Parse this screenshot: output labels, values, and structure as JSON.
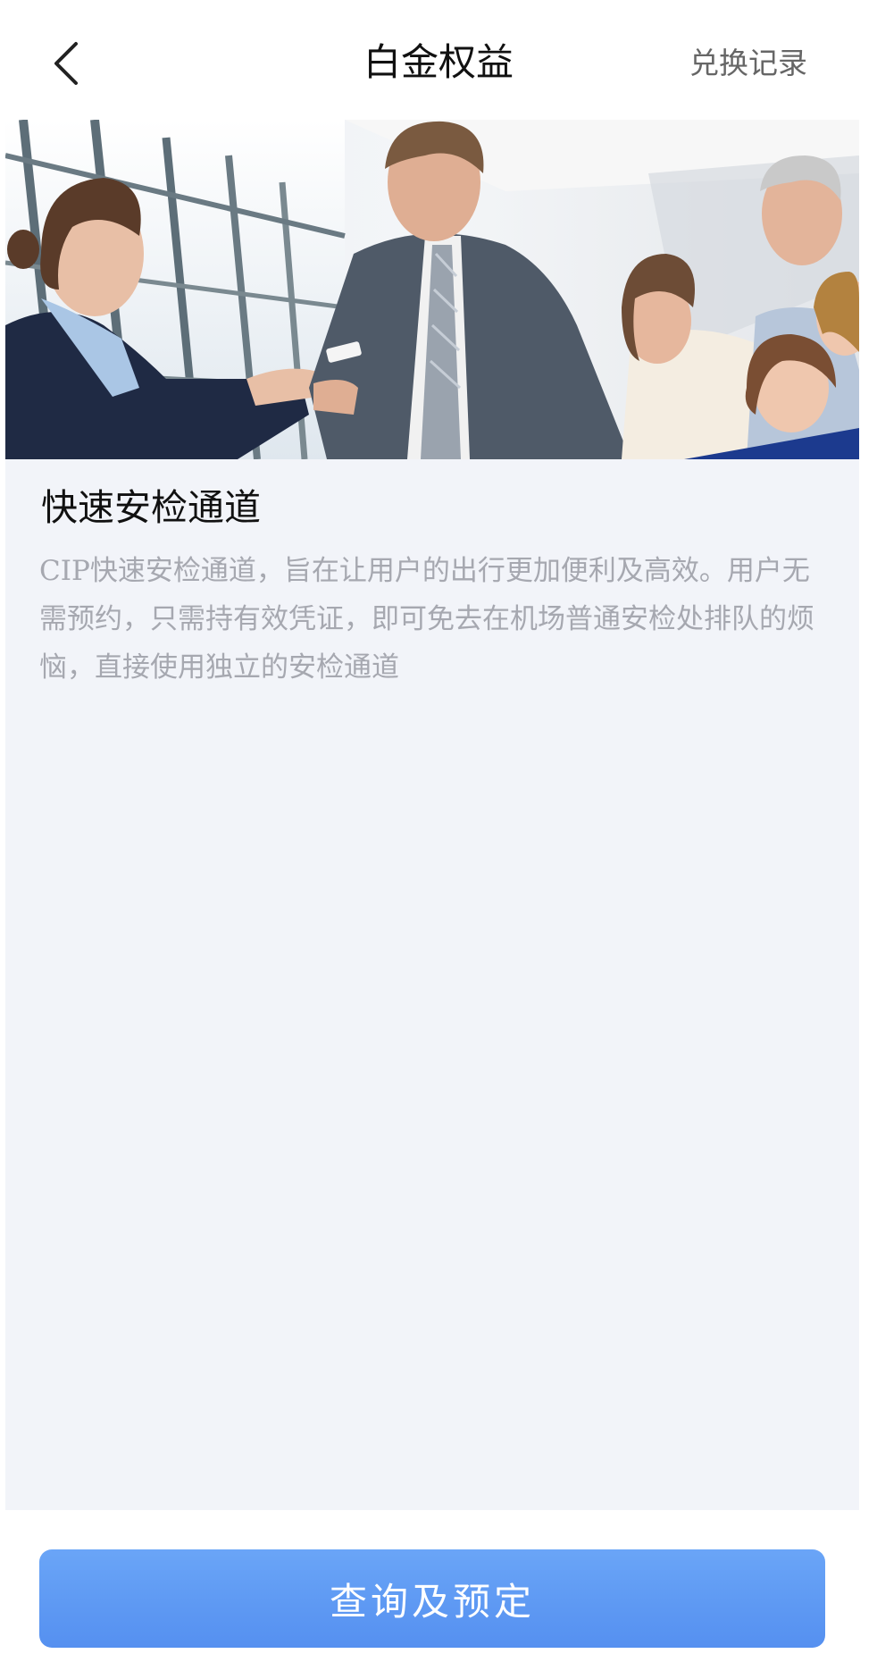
{
  "header": {
    "title": "白金权益",
    "right_link": "兑换记录"
  },
  "hero": {
    "description": "Airport staff checking a traveler's ticket beside a smiling family"
  },
  "benefit": {
    "title": "快速安检通道",
    "description": "CIP快速安检通道，旨在让用户的出行更加便利及高效。用户无需预约，只需持有效凭证，即可免去在机场普通安检处排队的烦恼，直接使用独立的安检通道"
  },
  "footer": {
    "cta_label": "查询及预定"
  },
  "colors": {
    "accent": "#5a95f2",
    "background": "#f2f4f9",
    "muted_text": "#a6a8b0"
  }
}
